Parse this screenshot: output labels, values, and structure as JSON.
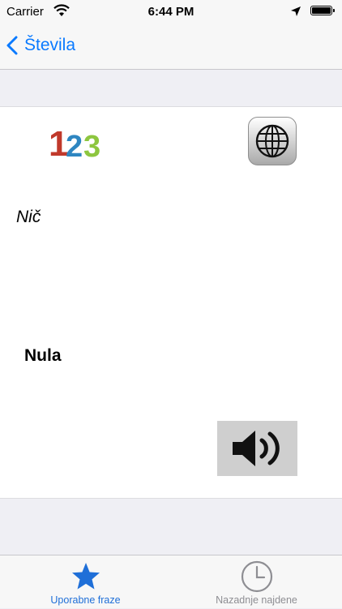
{
  "status_bar": {
    "carrier": "Carrier",
    "time": "6:44 PM",
    "icons": [
      "wifi-icon",
      "location-arrow-icon",
      "battery-icon"
    ]
  },
  "nav": {
    "back_label": "Števila",
    "back_icon": "chevron-left-icon"
  },
  "card": {
    "logo_icon": "numbers-123-icon",
    "logo_glyphs": [
      "1",
      "2",
      "3"
    ],
    "logo_colors": [
      "#c0392b",
      "#2e86c1",
      "#8dc63f"
    ],
    "language_button_icon": "globe-icon",
    "phrase_source": "Nič",
    "phrase_translation": "Nula",
    "speaker_button_icon": "speaker-icon"
  },
  "tabs": [
    {
      "label": "Uporabne fraze",
      "icon": "star-icon",
      "selected": true
    },
    {
      "label": "Nazadnje najdene",
      "icon": "clock-icon",
      "selected": false
    }
  ],
  "colors": {
    "accent": "#0a7aff",
    "tab_selected": "#1f6fd8",
    "tab_inactive": "#8e8e93"
  }
}
